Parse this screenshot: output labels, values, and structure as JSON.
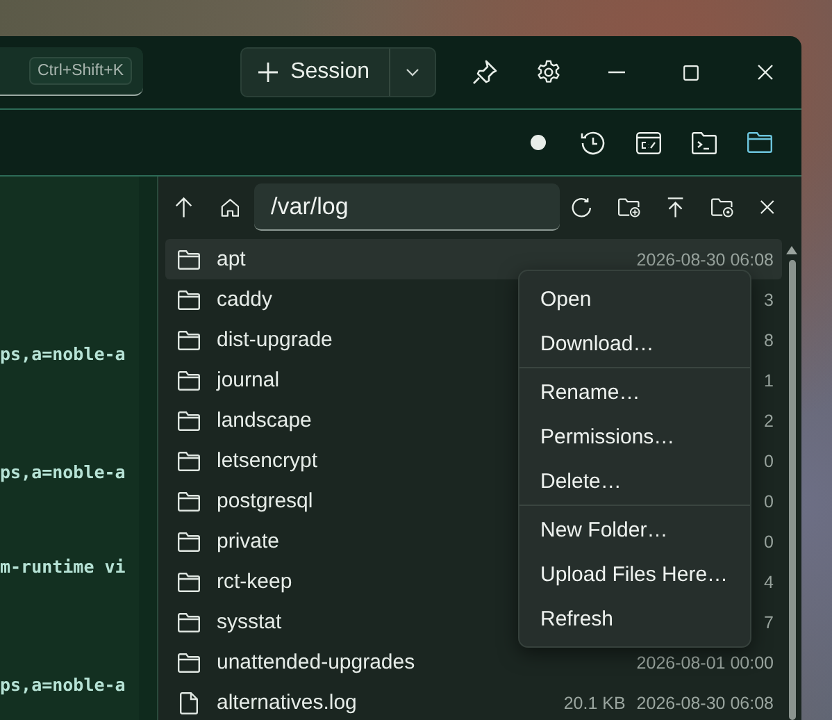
{
  "title_bar": {
    "tab_shortcut": "Ctrl+Shift+K",
    "session_button": "Session"
  },
  "toolbar_buttons": [
    {
      "kind": "status",
      "selected": false
    },
    {
      "kind": "history",
      "selected": false
    },
    {
      "kind": "cmd",
      "selected": false
    },
    {
      "kind": "terminal",
      "selected": false
    },
    {
      "kind": "files",
      "selected": true
    }
  ],
  "terminal_lines": [
    "ps,a=noble-a",
    "ps,a=noble-a",
    "m-runtime vi",
    "ps,a=noble-a"
  ],
  "file_browser": {
    "path": "/var/log",
    "entries": [
      {
        "kind": "folder",
        "name": "apt",
        "modified": "2026-08-30 06:08",
        "selected": true
      },
      {
        "kind": "folder",
        "name": "caddy",
        "modified": "3",
        "selected": false
      },
      {
        "kind": "folder",
        "name": "dist-upgrade",
        "modified": "8",
        "selected": false
      },
      {
        "kind": "folder",
        "name": "journal",
        "modified": "1",
        "selected": false
      },
      {
        "kind": "folder",
        "name": "landscape",
        "modified": "2",
        "selected": false
      },
      {
        "kind": "folder",
        "name": "letsencrypt",
        "modified": "0",
        "selected": false
      },
      {
        "kind": "folder",
        "name": "postgresql",
        "modified": "0",
        "selected": false
      },
      {
        "kind": "folder",
        "name": "private",
        "modified": "0",
        "selected": false
      },
      {
        "kind": "folder",
        "name": "rct-keep",
        "modified": "4",
        "selected": false
      },
      {
        "kind": "folder",
        "name": "sysstat",
        "modified": "7",
        "selected": false
      },
      {
        "kind": "folder",
        "name": "unattended-upgrades",
        "modified": "2026-08-01 00:00",
        "selected": false
      },
      {
        "kind": "file",
        "name": "alternatives.log",
        "size": "20.1 KB",
        "modified": "2026-08-30 06:08",
        "selected": false
      }
    ]
  },
  "context_menu": [
    [
      "Open",
      "Download…"
    ],
    [
      "Rename…",
      "Permissions…",
      "Delete…"
    ],
    [
      "New Folder…",
      "Upload Files Here…",
      "Refresh"
    ]
  ]
}
